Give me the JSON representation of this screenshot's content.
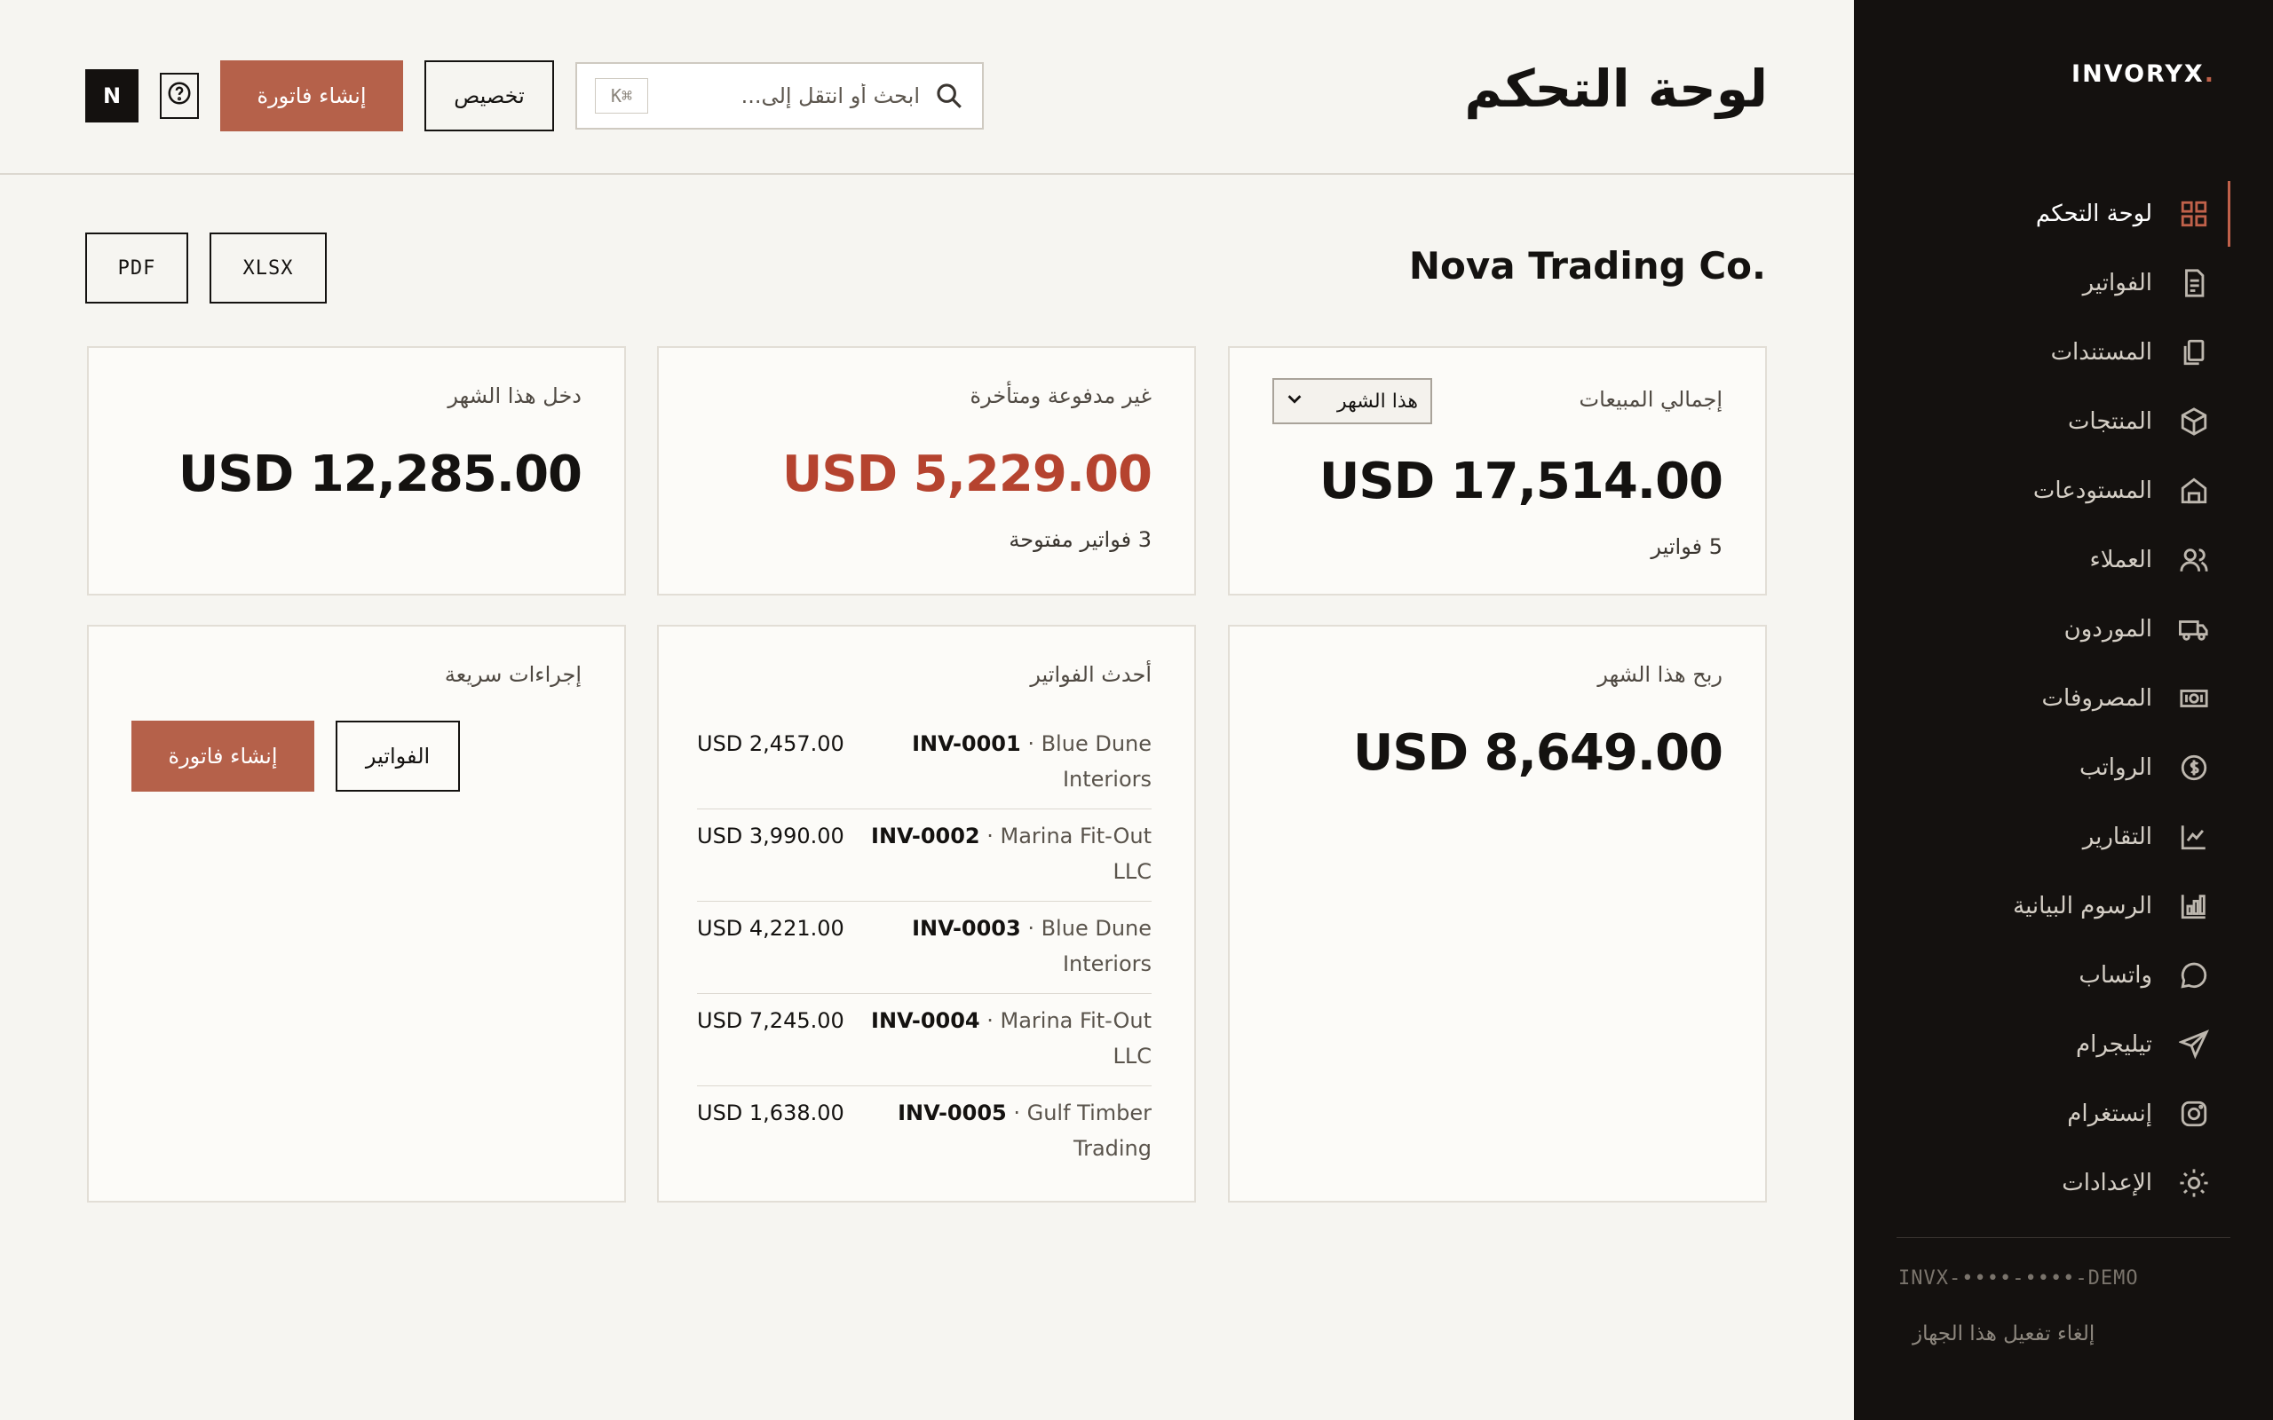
{
  "brand": {
    "name": "INVORYX",
    "dot": "."
  },
  "topbar": {
    "title": "لوحة التحكم",
    "search_placeholder": "ابحث أو انتقل إلى...",
    "shortcut": "K⌘",
    "customize_label": "تخصيص",
    "create_invoice_label": "إنشاء فاتورة",
    "avatar_initial": "N"
  },
  "company": {
    "name": "Nova Trading Co.",
    "export_pdf": "PDF",
    "export_xlsx": "XLSX"
  },
  "cards": {
    "sales": {
      "label": "إجمالي المبيعات",
      "period": "هذا الشهر",
      "amount": "USD 17,514.00",
      "sub": "5 فواتير"
    },
    "unpaid": {
      "label": "غير مدفوعة ومتأخرة",
      "amount": "USD 5,229.00",
      "sub": "3 فواتير مفتوحة"
    },
    "income": {
      "label": "دخل هذا الشهر",
      "amount": "USD 12,285.00"
    },
    "profit": {
      "label": "ربح هذا الشهر",
      "amount": "USD 8,649.00"
    },
    "recent_invoices": {
      "label": "أحدث الفواتير",
      "items": [
        {
          "number": "INV-0001",
          "client": "Blue Dune Interiors",
          "amount": "USD 2,457.00"
        },
        {
          "number": "INV-0002",
          "client": "Marina Fit-Out LLC",
          "amount": "USD 3,990.00"
        },
        {
          "number": "INV-0003",
          "client": "Blue Dune Interiors",
          "amount": "USD 4,221.00"
        },
        {
          "number": "INV-0004",
          "client": "Marina Fit-Out LLC",
          "amount": "USD 7,245.00"
        },
        {
          "number": "INV-0005",
          "client": "Gulf Timber Trading",
          "amount": "USD 1,638.00"
        }
      ]
    },
    "quick_actions": {
      "label": "إجراءات سريعة",
      "create_invoice": "إنشاء فاتورة",
      "invoices": "الفواتير"
    }
  },
  "sidebar": {
    "items": [
      {
        "label": "لوحة التحكم",
        "icon": "dashboard-icon",
        "active": true
      },
      {
        "label": "الفواتير",
        "icon": "invoice-icon"
      },
      {
        "label": "المستندات",
        "icon": "documents-icon"
      },
      {
        "label": "المنتجات",
        "icon": "box-icon"
      },
      {
        "label": "المستودعات",
        "icon": "warehouse-icon"
      },
      {
        "label": "العملاء",
        "icon": "users-icon"
      },
      {
        "label": "الموردون",
        "icon": "truck-icon"
      },
      {
        "label": "المصروفات",
        "icon": "banknote-icon"
      },
      {
        "label": "الرواتب",
        "icon": "coin-icon"
      },
      {
        "label": "التقارير",
        "icon": "line-chart-icon"
      },
      {
        "label": "الرسوم البيانية",
        "icon": "bar-chart-icon"
      },
      {
        "label": "واتساب",
        "icon": "chat-icon"
      },
      {
        "label": "تيليجرام",
        "icon": "send-icon"
      },
      {
        "label": "إنستغرام",
        "icon": "instagram-icon"
      },
      {
        "label": "الإعدادات",
        "icon": "settings-icon"
      }
    ],
    "license": "INVX-••••-••••-DEMO",
    "deactivate_label": "إلغاء تفعيل هذا الجهاز"
  },
  "colors": {
    "accent": "#b5614a",
    "danger": "#b5432f",
    "sidebar_bg": "#14110f",
    "page_bg": "#f6f5f1"
  }
}
